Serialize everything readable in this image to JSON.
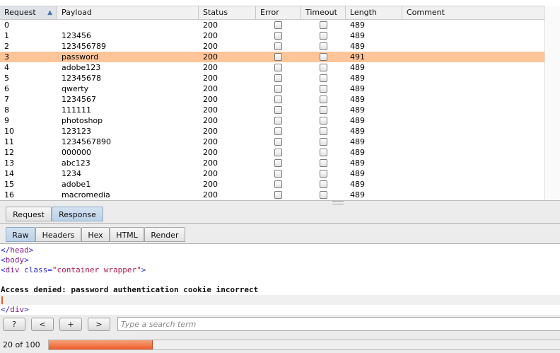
{
  "table": {
    "columns": [
      "Request",
      "Payload",
      "Status",
      "Error",
      "Timeout",
      "Length",
      "Comment"
    ],
    "sort_indicator": "▲",
    "selected_index": 3,
    "rows": [
      {
        "request": "0",
        "payload": "",
        "status": "200",
        "error": false,
        "timeout": false,
        "length": "489",
        "comment": ""
      },
      {
        "request": "1",
        "payload": "123456",
        "status": "200",
        "error": false,
        "timeout": false,
        "length": "489",
        "comment": ""
      },
      {
        "request": "2",
        "payload": "123456789",
        "status": "200",
        "error": false,
        "timeout": false,
        "length": "489",
        "comment": ""
      },
      {
        "request": "3",
        "payload": "password",
        "status": "200",
        "error": false,
        "timeout": false,
        "length": "491",
        "comment": ""
      },
      {
        "request": "4",
        "payload": "adobe123",
        "status": "200",
        "error": false,
        "timeout": false,
        "length": "489",
        "comment": ""
      },
      {
        "request": "5",
        "payload": "12345678",
        "status": "200",
        "error": false,
        "timeout": false,
        "length": "489",
        "comment": ""
      },
      {
        "request": "6",
        "payload": "qwerty",
        "status": "200",
        "error": false,
        "timeout": false,
        "length": "489",
        "comment": ""
      },
      {
        "request": "7",
        "payload": "1234567",
        "status": "200",
        "error": false,
        "timeout": false,
        "length": "489",
        "comment": ""
      },
      {
        "request": "8",
        "payload": "111111",
        "status": "200",
        "error": false,
        "timeout": false,
        "length": "489",
        "comment": ""
      },
      {
        "request": "9",
        "payload": "photoshop",
        "status": "200",
        "error": false,
        "timeout": false,
        "length": "489",
        "comment": ""
      },
      {
        "request": "10",
        "payload": "123123",
        "status": "200",
        "error": false,
        "timeout": false,
        "length": "489",
        "comment": ""
      },
      {
        "request": "11",
        "payload": "1234567890",
        "status": "200",
        "error": false,
        "timeout": false,
        "length": "489",
        "comment": ""
      },
      {
        "request": "12",
        "payload": "000000",
        "status": "200",
        "error": false,
        "timeout": false,
        "length": "489",
        "comment": ""
      },
      {
        "request": "13",
        "payload": "abc123",
        "status": "200",
        "error": false,
        "timeout": false,
        "length": "489",
        "comment": ""
      },
      {
        "request": "14",
        "payload": "1234",
        "status": "200",
        "error": false,
        "timeout": false,
        "length": "489",
        "comment": ""
      },
      {
        "request": "15",
        "payload": "adobe1",
        "status": "200",
        "error": false,
        "timeout": false,
        "length": "489",
        "comment": ""
      },
      {
        "request": "16",
        "payload": "macromedia",
        "status": "200",
        "error": false,
        "timeout": false,
        "length": "489",
        "comment": ""
      }
    ]
  },
  "detail_tabs": [
    {
      "label": "Request",
      "active": false
    },
    {
      "label": "Response",
      "active": true
    }
  ],
  "view_tabs": [
    {
      "label": "Raw",
      "active": true
    },
    {
      "label": "Headers",
      "active": false
    },
    {
      "label": "Hex",
      "active": false
    },
    {
      "label": "HTML",
      "active": false
    },
    {
      "label": "Render",
      "active": false
    }
  ],
  "response": {
    "close_head": {
      "open": "</",
      "tag": "head",
      "close": ">"
    },
    "body_open": {
      "open": "<",
      "tag": "body",
      "close": ">"
    },
    "div_open": {
      "open": "<",
      "tag": "div",
      "attr": "class",
      "eq": "=",
      "value": "\"container wrapper\"",
      "close": ">"
    },
    "message": "Access denied: password authentication cookie incorrect",
    "close_div": {
      "open": "</",
      "tag": "div",
      "close": ">"
    }
  },
  "search": {
    "help_label": "?",
    "prev_label": "<",
    "add_label": "+",
    "next_label": ">",
    "placeholder": "Type a search term"
  },
  "progress": {
    "label": "20 of 100",
    "done": 20,
    "total": 100
  },
  "colors": {
    "selected_row": "#ffc599",
    "progress_fill": "#ec5b28",
    "active_tab": "#bcd2e8"
  }
}
